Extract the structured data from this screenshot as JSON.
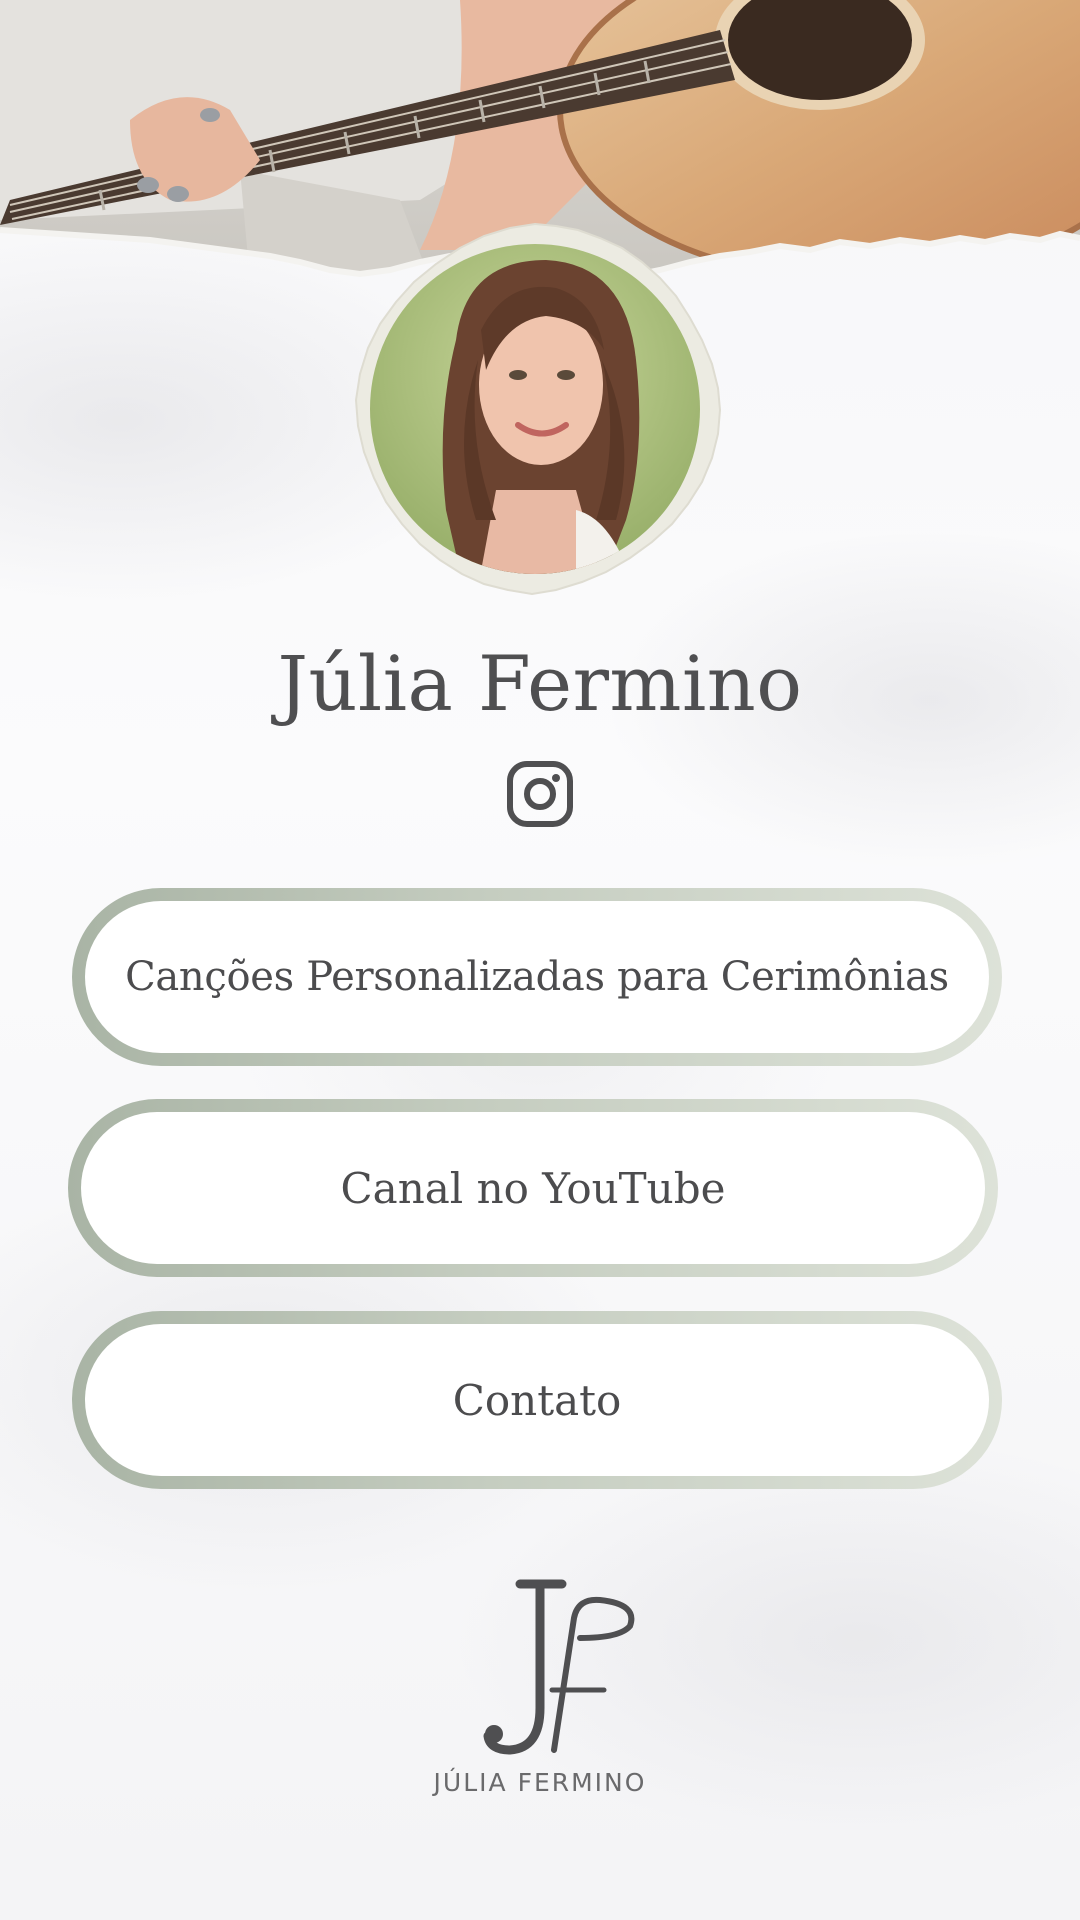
{
  "profile": {
    "name": "Júlia Fermino",
    "social_icons": [
      "instagram-icon"
    ]
  },
  "links": [
    {
      "label": "Canções Personalizadas para Cerimônias"
    },
    {
      "label": "Canal no YouTube"
    },
    {
      "label": "Contato"
    }
  ],
  "footer": {
    "logo_monogram": "JF",
    "logo_text": "JÚLIA FERMINO"
  },
  "colors": {
    "text": "#4f4f51",
    "button_border_start": "#a9b4a5",
    "button_border_end": "#dde2d8",
    "background": "#f7f7f9"
  }
}
